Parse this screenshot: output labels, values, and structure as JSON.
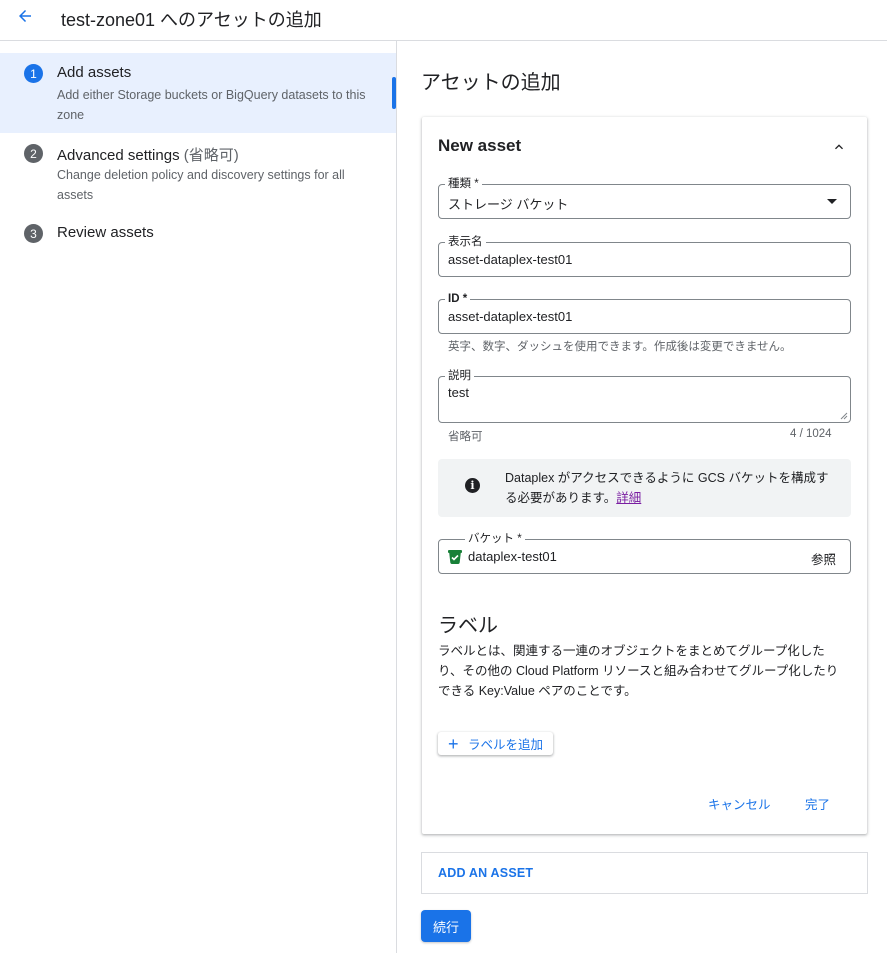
{
  "header": {
    "title": "test-zone01 へのアセットの追加",
    "back_icon": "arrow-left-icon"
  },
  "stepper": {
    "steps": [
      {
        "number": "1",
        "title": "Add assets",
        "optional": "",
        "description": "Add either Storage buckets or BigQuery datasets to this zone",
        "active": true
      },
      {
        "number": "2",
        "title": "Advanced settings",
        "optional": "(省略可)",
        "description": "Change deletion policy and discovery settings for all assets",
        "active": false
      },
      {
        "number": "3",
        "title": "Review assets",
        "optional": "",
        "description": "",
        "active": false
      }
    ]
  },
  "main": {
    "section_title": "アセットの追加",
    "card": {
      "title": "New asset",
      "type_field": {
        "label": "種類 *",
        "value": "ストレージ バケット"
      },
      "display_name_field": {
        "label": "表示名",
        "value": "asset-dataplex-test01"
      },
      "id_field": {
        "label": "ID *",
        "value": "asset-dataplex-test01",
        "hint": "英字、数字、ダッシュを使用できます。作成後は変更できません。"
      },
      "description_field": {
        "label": "説明",
        "value": "test",
        "hint": "省略可",
        "counter": "4 / 1024"
      },
      "info": {
        "text": "Dataplex がアクセスできるように GCS バケットを構成する必要があります。",
        "link": "詳細"
      },
      "bucket_field": {
        "label": "バケット *",
        "value": "dataplex-test01",
        "browse": "参照"
      },
      "labels": {
        "title": "ラベル",
        "description": "ラベルとは、関連する一連のオブジェクトをまとめてグループ化したり、その他の Cloud Platform リソースと組み合わせてグループ化したりできる Key:Value ペアのことです。",
        "add_button": "ラベルを追加"
      },
      "cancel": "キャンセル",
      "done": "完了"
    },
    "add_asset": "ADD AN ASSET",
    "continue": "続行"
  },
  "colors": {
    "accent": "#1a73e8",
    "active_step_bg": "#e8f0fe",
    "bucket_icon": "#188038",
    "link": "#7b1fa2"
  }
}
